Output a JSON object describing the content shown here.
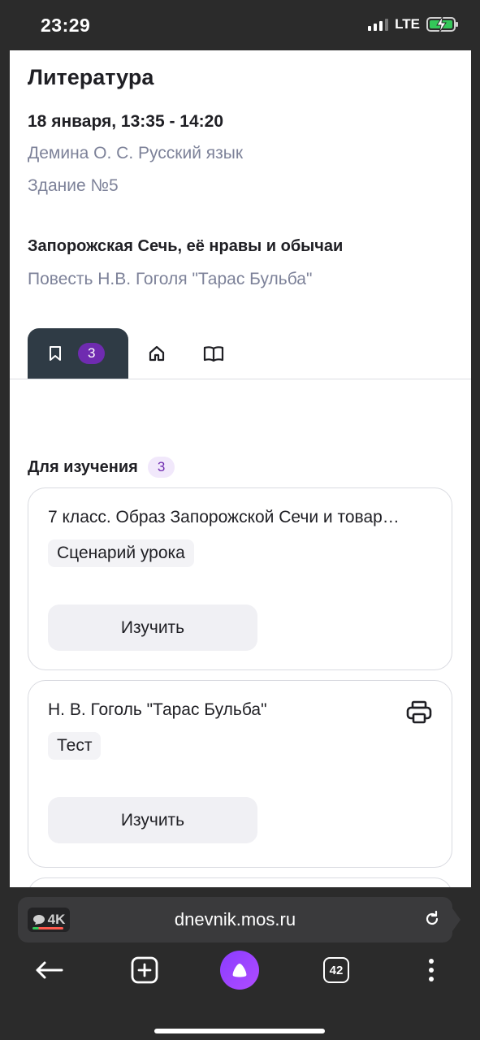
{
  "status": {
    "time": "23:29",
    "network": "LTE"
  },
  "lesson": {
    "title": "Литература",
    "datetime": "18 января, 13:35 - 14:20",
    "teacher": "Демина О. С. Русский язык",
    "building": "Здание №5",
    "topic": "Запорожская Сечь, её нравы и обычаи",
    "subtopic": "Повесть Н.В. Гоголя \"Тарас Бульба\""
  },
  "tabs": {
    "items": [
      {
        "icon": "bookmark-icon",
        "badge": "3",
        "active": true
      },
      {
        "icon": "home-icon",
        "active": false
      },
      {
        "icon": "book-icon",
        "active": false
      }
    ]
  },
  "materials": {
    "section_title": "Для изучения",
    "count": "3",
    "cards": [
      {
        "title": "7 класс. Образ Запорожской Сечи и товар…",
        "tag": "Сценарий урока",
        "button": "Изучить"
      },
      {
        "title": "Н. В. Гоголь \"Тарас Бульба\"",
        "tag": "Тест",
        "button": "Изучить",
        "action_icon": "print-icon"
      }
    ]
  },
  "browser": {
    "url": "dnevnik.mos.ru",
    "badge": "4K",
    "tab_count": "42"
  },
  "colors": {
    "accent": "#6f2bb0",
    "tab_dark": "#2f3b45",
    "muted_text": "#7d8299"
  }
}
